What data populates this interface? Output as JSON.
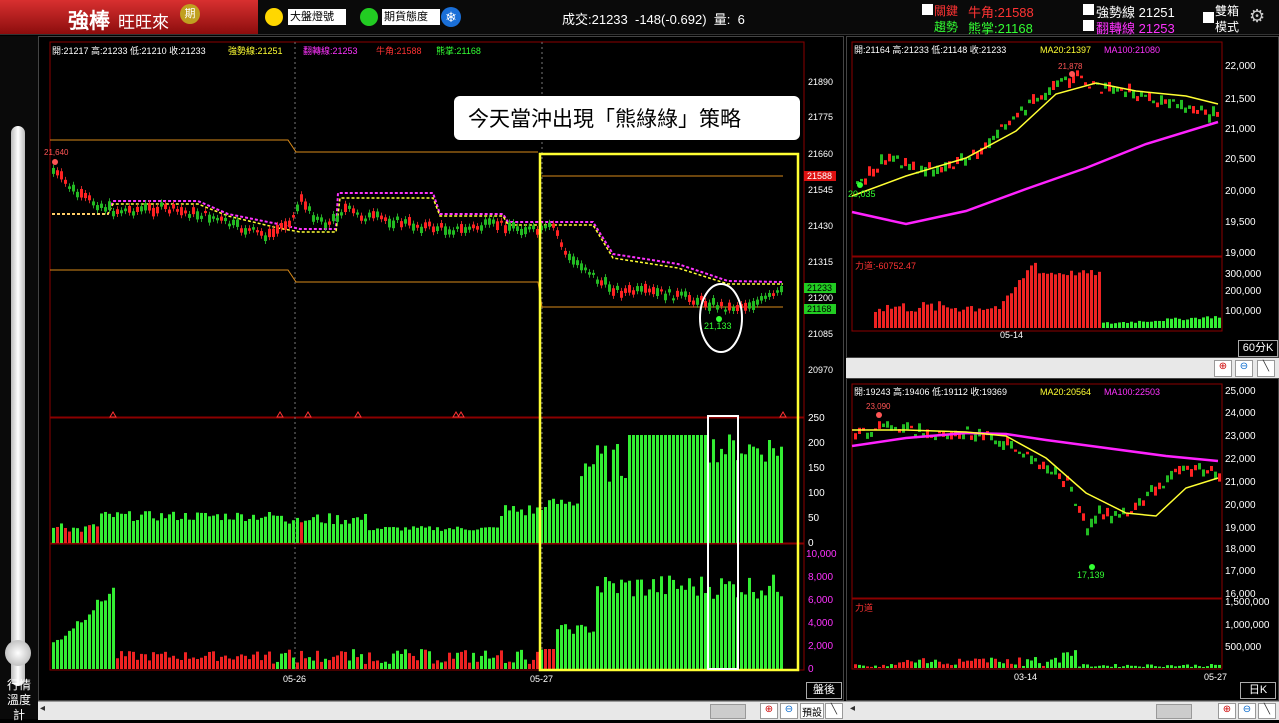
{
  "brand": {
    "title": "強棒",
    "subtitle": "旺旺來",
    "badge": "期"
  },
  "toolbar": {
    "signal_label": "大盤燈號",
    "futures_label": "期貨態度",
    "snow_icon": "snowflake-icon",
    "trade_text": "成交:21233  -148(-0.692)  量:  6",
    "key_label": "關鍵",
    "trend_label": "趨勢",
    "bull_text": "牛角:21588",
    "bear_text": "熊掌:21168",
    "strong_text": "強勢線 21251",
    "turn_text": "翻轉線 21253",
    "dual_label": "雙箱",
    "mode_label": "模式",
    "colors": {
      "bull": "#ff3333",
      "bear": "#33ff33",
      "strong": "#ffffff",
      "turn": "#ff33ff"
    }
  },
  "thermometer": {
    "label_line1": "行情",
    "label_line2": "溫度計"
  },
  "main_chart": {
    "info_ohlc": "開:21217 高:21233 低:21210 收:21233",
    "info_strong": "強勢線:21251",
    "info_turn": "翻轉線:21253",
    "info_bull": "牛角:21588",
    "info_bear": "熊掌:21168",
    "price_axis": [
      "21890",
      "21775",
      "21660",
      "21545",
      "21430",
      "21315",
      "21200",
      "21085",
      "20970"
    ],
    "price_badges": {
      "bull": "21588",
      "close": "21233",
      "bear": "21168"
    },
    "annot_high": "21,640",
    "annot_low": "21,133",
    "callout": "今天當沖出現「熊綠綠」策略",
    "vol_axis": [
      "250",
      "200",
      "150",
      "100",
      "50",
      "0"
    ],
    "vol2_axis": [
      "10,000",
      "8,000",
      "6,000",
      "4,000",
      "2,000",
      "0"
    ],
    "date_labels": [
      "05-26",
      "05-27"
    ],
    "after_hours_button": "盤後"
  },
  "chart_60": {
    "info_ohlc": "開:21164 高:21233 低:21148 收:21233",
    "info_ma20": "MA20:21397",
    "info_ma100": "MA100:21080",
    "price_axis": [
      "22,000",
      "21,500",
      "21,000",
      "20,500",
      "20,000",
      "19,500",
      "19,000"
    ],
    "annot_high": "21,878",
    "annot_low": "20,035",
    "power_label": "力道:-60752.47",
    "power_axis": [
      "300,000",
      "200,000",
      "100,000"
    ],
    "date_label": "05-14",
    "period_button": "60分K"
  },
  "chart_day": {
    "info_ohlc": "開:19243 高:19406 低:19112 收:19369",
    "info_ma20": "MA20:20564",
    "info_ma100": "MA100:22503",
    "price_axis": [
      "25,000",
      "24,000",
      "23,000",
      "22,000",
      "21,000",
      "20,000",
      "19,000",
      "18,000",
      "17,000",
      "16,000"
    ],
    "annot_high": "23,090",
    "annot_low": "17,139",
    "power_label": "力道",
    "power_axis": [
      "1,500,000",
      "1,000,000",
      "500,000"
    ],
    "date_labels": [
      "03-14",
      "05-27"
    ],
    "period_button": "日K"
  },
  "bottom": {
    "preset_label": "預設"
  }
}
